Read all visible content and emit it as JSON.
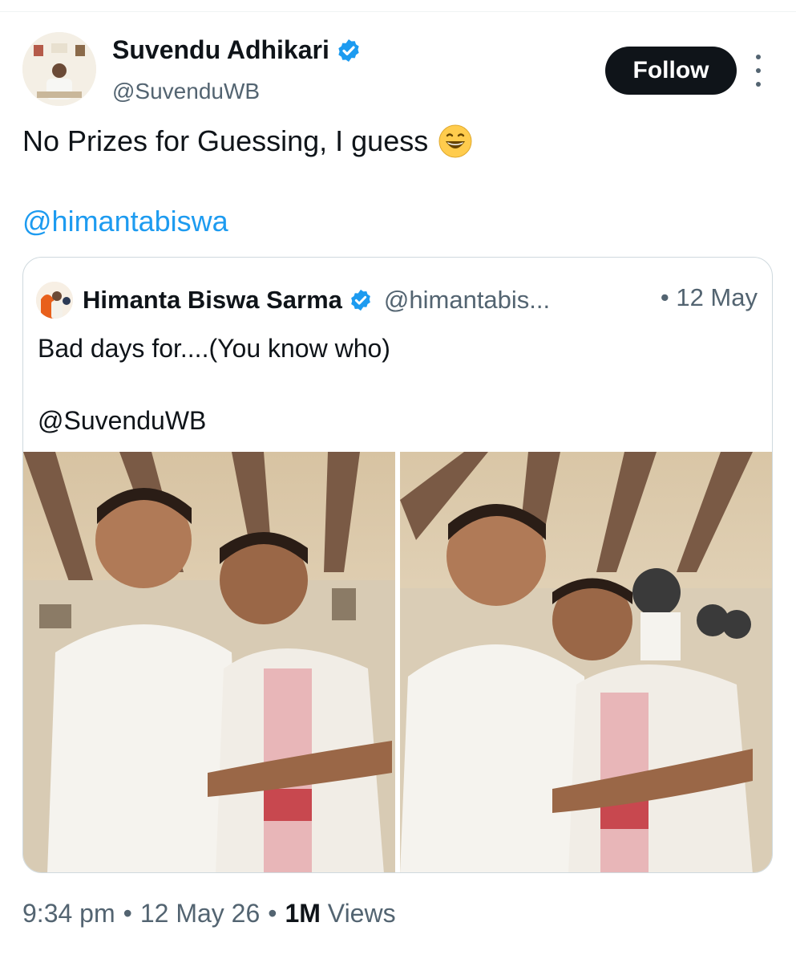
{
  "author": {
    "display_name": "Suvendu Adhikari",
    "handle": "@SuvenduWB",
    "verified": true,
    "avatar_icon": "profile-photo"
  },
  "actions": {
    "follow_label": "Follow",
    "more_icon": "more-vertical-icon"
  },
  "tweet": {
    "text": "No Prizes for Guessing, I guess",
    "emoji": "grinning-face-icon",
    "mention": "@himantabiswa"
  },
  "quoted": {
    "display_name": "Himanta Biswa Sarma",
    "handle": "@himantabis...",
    "date": "• 12 May",
    "text": "Bad days for....(You know who)",
    "mention": "@SuvenduWB",
    "photos": [
      "photo-1",
      "photo-2"
    ]
  },
  "meta": {
    "time": "9:34 pm",
    "sep1": "•",
    "date": "12 May 26",
    "sep2": "•",
    "views_count": "1M",
    "views_label": "Views"
  },
  "colors": {
    "accent": "#1d9bf0",
    "text": "#0f1419",
    "muted": "#536471",
    "border": "#cfd9de"
  }
}
